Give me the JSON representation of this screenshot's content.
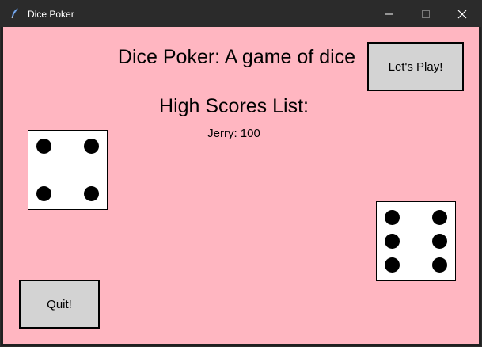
{
  "window": {
    "title": "Dice Poker",
    "titlebar_color": "#2b2b2b",
    "background_color": "#ffb6c1",
    "controls": [
      "minimize-icon",
      "maximize-icon",
      "close-icon"
    ]
  },
  "main": {
    "title": "Dice Poker: A game of dice",
    "scores_heading": "High Scores List:",
    "scores": [
      {
        "entry": "Jerry: 100"
      }
    ]
  },
  "buttons": {
    "play_label": "Let's Play!",
    "quit_label": "Quit!",
    "button_color": "#d3d3d3"
  },
  "dice": [
    {
      "value": 4
    },
    {
      "value": 6
    }
  ]
}
